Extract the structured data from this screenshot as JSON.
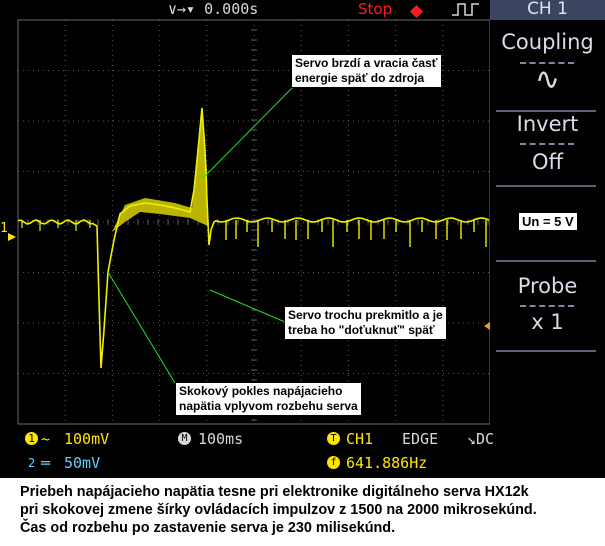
{
  "topbar": {
    "trigger_pos": "∨→▾ 0.000s",
    "state": "Stop",
    "channel_header": "CH 1"
  },
  "side_panel": {
    "coupling_label": "Coupling",
    "coupling_value": "∿",
    "invert_label": "Invert",
    "invert_value": "Off",
    "probe_label": "Probe",
    "probe_value": "x 1"
  },
  "status": {
    "ch1_num": "1",
    "ch1_coupling": "~",
    "ch1_scale": "100mV",
    "ch2_num": "2",
    "ch2_coupling": "═",
    "ch2_scale": "50mV",
    "time_prefix": "M",
    "time_scale": "100ms",
    "trigger_source": "CH1",
    "trigger_type": "EDGE",
    "trigger_coupling": "↘DC",
    "frequency_prefix": "f",
    "frequency": "641.886Hz"
  },
  "channel_marker": "1",
  "annotations": {
    "braking": [
      "Servo brzdí a vracia časť",
      "energie späť do zdroja"
    ],
    "overshoot": [
      "Servo trochu prekmitlo a je",
      "treba ho \"doťuknuť\" späť"
    ],
    "drop": [
      "Skokový pokles napájacieho",
      "napätia vplyvom rozbehu serva"
    ],
    "voltage": "Un = 5 V"
  },
  "caption": [
    "Priebeh napájacieho napätia tesne pri elektronike digitálneho serva HX12k",
    "pri skokovej zmene šírky ovládacích impulzov z 1500 na 2000 mikrosekúnd.",
    "Čas od rozbehu po zastavenie serva je 230 milisekúnd."
  ],
  "colors": {
    "trace": "#f0f000",
    "status_yellow": "#ffe600",
    "status_blue": "#5fd0ff",
    "stop_red": "#ff1a1a",
    "leader_green": "#22dd22",
    "grid": "#5a5a5a"
  }
}
